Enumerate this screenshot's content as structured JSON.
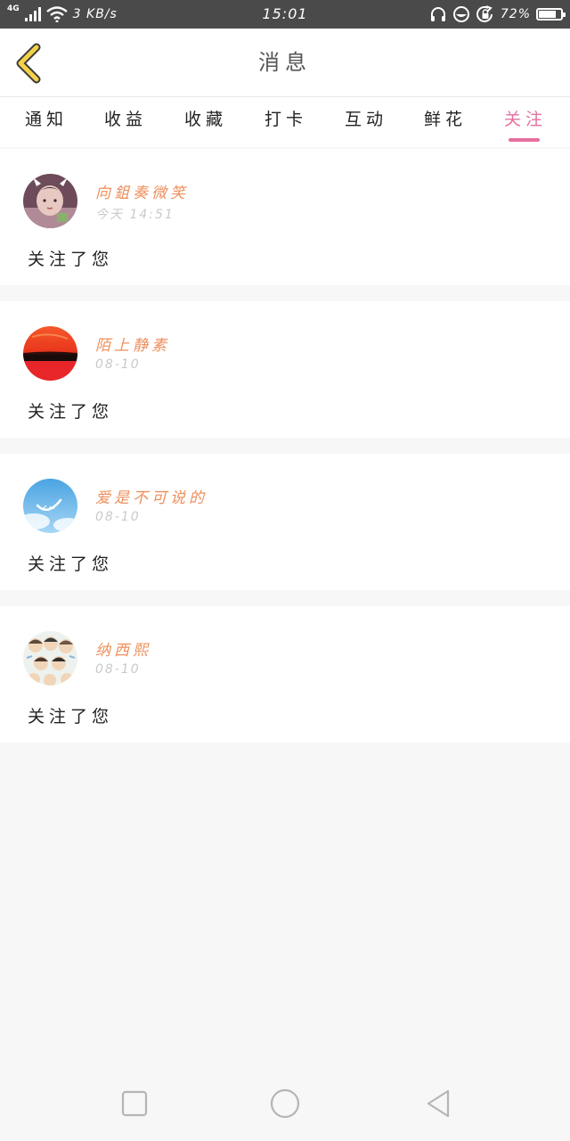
{
  "status_bar": {
    "network": "4G",
    "speed": "3 KB/s",
    "time": "15:01",
    "battery": "72%",
    "battery_level": 0.72
  },
  "header": {
    "title": "消息",
    "back_icon": "chevron-left-icon",
    "back_icon_color": "#f3d24a"
  },
  "tabs": [
    {
      "label": "通知"
    },
    {
      "label": "收益"
    },
    {
      "label": "收藏"
    },
    {
      "label": "打卡"
    },
    {
      "label": "互动"
    },
    {
      "label": "鲜花"
    },
    {
      "label": "关注",
      "active": true
    }
  ],
  "accent_color": "#e66fa0",
  "username_color": "#ef8f5c",
  "messages": [
    {
      "name": "向鉏奏微笑",
      "time": "今天 14:51",
      "text": "关注了您"
    },
    {
      "name": "陌上静素",
      "time": "08-10",
      "text": "关注了您"
    },
    {
      "name": "爱是不可说的",
      "time": "08-10",
      "text": "关注了您"
    },
    {
      "name": "纳西熙",
      "time": "08-10",
      "text": "关注了您"
    }
  ],
  "nav": {
    "recent_icon": "square-icon",
    "home_icon": "circle-icon",
    "back_icon": "triangle-back-icon"
  }
}
